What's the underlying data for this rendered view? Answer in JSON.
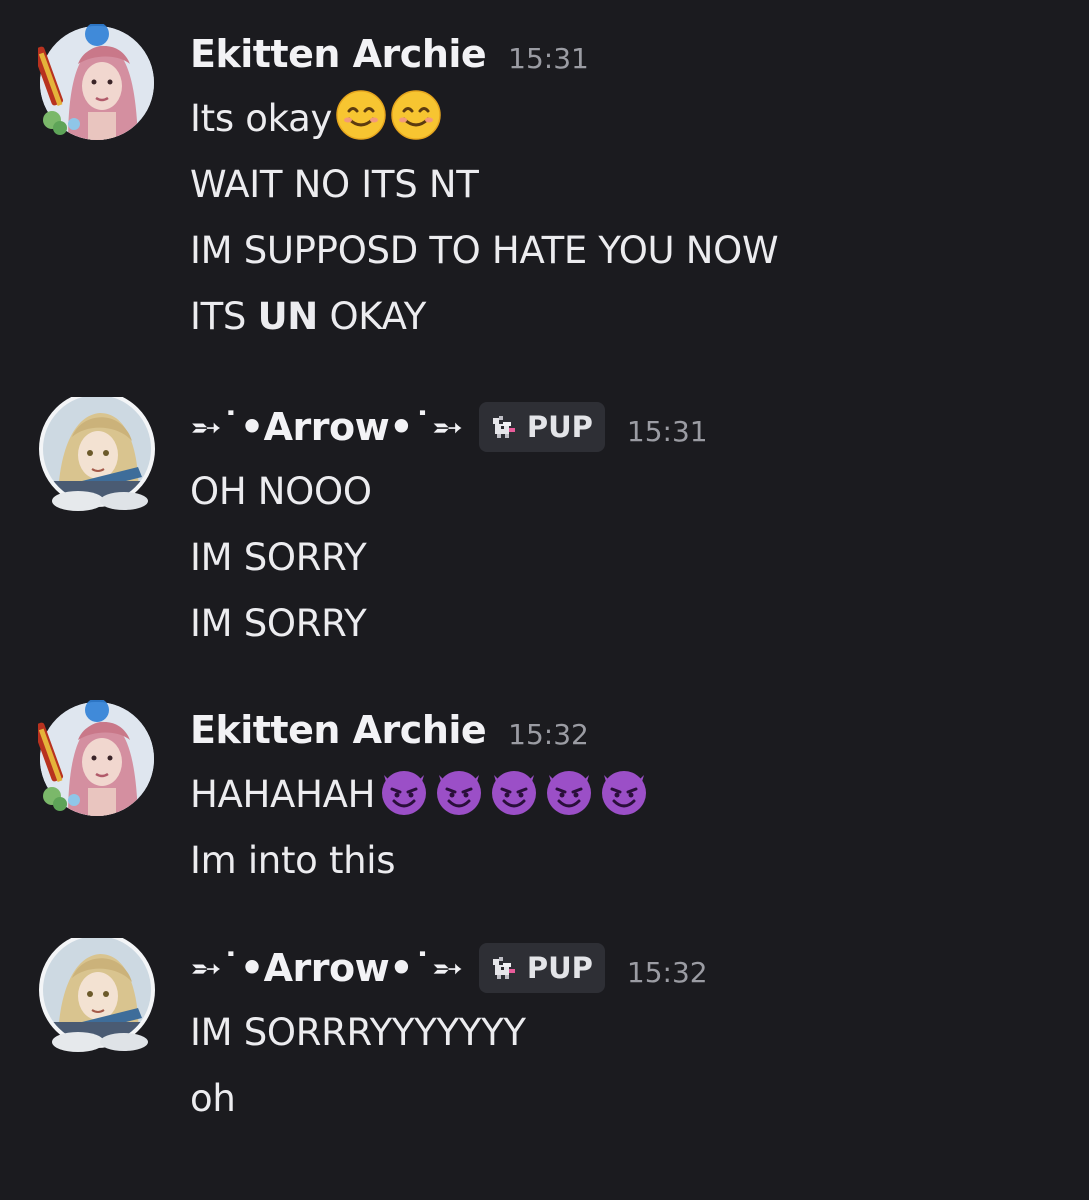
{
  "messages": [
    {
      "author": "Ekitten Archie",
      "tag": "",
      "time": "15:31",
      "avatar": "pink-hair-girl-avatar",
      "lines": [
        {
          "text": "Its okay",
          "emoji": "smiling-face-emoji",
          "emoji_count": 2
        },
        {
          "text": "WAIT NO ITS NT"
        },
        {
          "text": "IM SUPPOSD TO HATE YOU NOW"
        },
        {
          "pre": "ITS ",
          "bold": "UN",
          "post": " OKAY"
        }
      ]
    },
    {
      "author": "➵˙•Arrow•˙➵",
      "tag": "PUP",
      "time": "15:31",
      "avatar": "blonde-anime-character-avatar",
      "lines": [
        {
          "text": "OH NOOO"
        },
        {
          "text": "IM SORRY"
        },
        {
          "text": "IM SORRY"
        }
      ]
    },
    {
      "author": "Ekitten Archie",
      "tag": "",
      "time": "15:32",
      "avatar": "pink-hair-girl-avatar",
      "lines": [
        {
          "text": "HAHAHAH",
          "emoji": "smiling-devil-emoji",
          "emoji_count": 5
        },
        {
          "text": "Im into this"
        }
      ]
    },
    {
      "author": "➵˙•Arrow•˙➵",
      "tag": "PUP",
      "time": "15:32",
      "avatar": "blonde-anime-character-avatar",
      "lines": [
        {
          "text": "IM SORRRYYYYYYY"
        },
        {
          "text": "oh"
        }
      ]
    }
  ],
  "colors": {
    "background": "#1b1b1f",
    "text": "#ececef",
    "timestamp": "#9b9ca3",
    "tag_background": "#2e2f35"
  }
}
